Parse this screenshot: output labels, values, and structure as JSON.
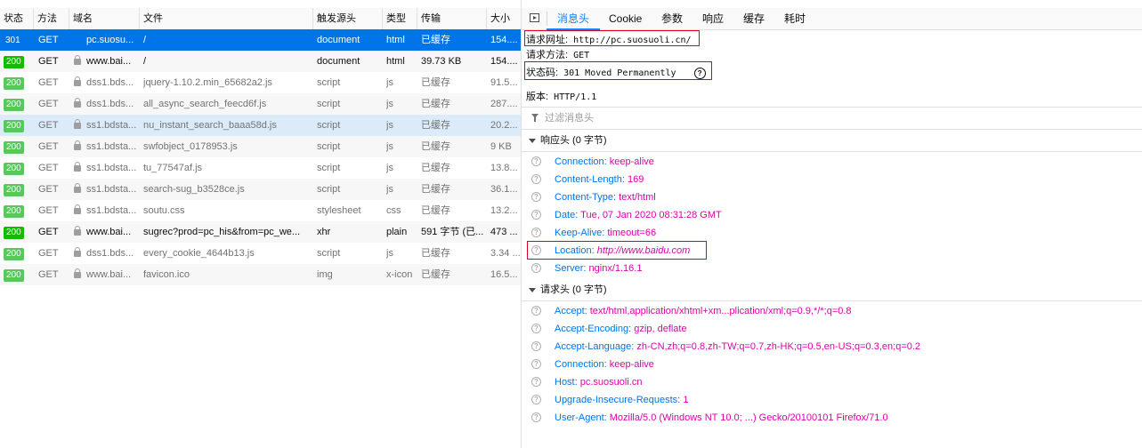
{
  "table": {
    "columns": [
      "状态",
      "方法",
      "域名",
      "文件",
      "触发源头",
      "类型",
      "传输",
      "大小"
    ],
    "rows": [
      {
        "status": "301",
        "method": "GET",
        "domain": "pc.suosu...",
        "lock": false,
        "file": "/",
        "cause": "document",
        "type": "html",
        "transferred": "已缓存",
        "size": "154...."
      },
      {
        "status": "200",
        "method": "GET",
        "domain": "www.bai...",
        "lock": true,
        "file": "/",
        "cause": "document",
        "type": "html",
        "transferred": "39.73 KB",
        "size": "154...."
      },
      {
        "status": "200",
        "method": "GET",
        "domain": "dss1.bds...",
        "lock": true,
        "file": "jquery-1.10.2.min_65682a2.js",
        "cause": "script",
        "type": "js",
        "transferred": "已缓存",
        "size": "91.5..."
      },
      {
        "status": "200",
        "method": "GET",
        "domain": "dss1.bds...",
        "lock": true,
        "file": "all_async_search_feecd6f.js",
        "cause": "script",
        "type": "js",
        "transferred": "已缓存",
        "size": "287...."
      },
      {
        "status": "200",
        "method": "GET",
        "domain": "ss1.bdsta...",
        "lock": true,
        "file": "nu_instant_search_baaa58d.js",
        "cause": "script",
        "type": "js",
        "transferred": "已缓存",
        "size": "20.2..."
      },
      {
        "status": "200",
        "method": "GET",
        "domain": "ss1.bdsta...",
        "lock": true,
        "file": "swfobject_0178953.js",
        "cause": "script",
        "type": "js",
        "transferred": "已缓存",
        "size": "9 KB"
      },
      {
        "status": "200",
        "method": "GET",
        "domain": "ss1.bdsta...",
        "lock": true,
        "file": "tu_77547af.js",
        "cause": "script",
        "type": "js",
        "transferred": "已缓存",
        "size": "13.8..."
      },
      {
        "status": "200",
        "method": "GET",
        "domain": "ss1.bdsta...",
        "lock": true,
        "file": "search-sug_b3528ce.js",
        "cause": "script",
        "type": "js",
        "transferred": "已缓存",
        "size": "36.1..."
      },
      {
        "status": "200",
        "method": "GET",
        "domain": "ss1.bdsta...",
        "lock": true,
        "file": "soutu.css",
        "cause": "stylesheet",
        "type": "css",
        "transferred": "已缓存",
        "size": "13.2..."
      },
      {
        "status": "200",
        "method": "GET",
        "domain": "www.bai...",
        "lock": true,
        "file": "sugrec?prod=pc_his&from=pc_we...",
        "cause": "xhr",
        "type": "plain",
        "transferred": "591 字节 (已...",
        "size": "473 ..."
      },
      {
        "status": "200",
        "method": "GET",
        "domain": "dss1.bds...",
        "lock": true,
        "file": "every_cookie_4644b13.js",
        "cause": "script",
        "type": "js",
        "transferred": "已缓存",
        "size": "3.34 ..."
      },
      {
        "status": "200",
        "method": "GET",
        "domain": "www.bai...",
        "lock": true,
        "file": "favicon.ico",
        "cause": "img",
        "type": "x-icon",
        "transferred": "已缓存",
        "size": "16.5..."
      }
    ]
  },
  "tabs": [
    "消息头",
    "Cookie",
    "参数",
    "响应",
    "缓存",
    "耗时"
  ],
  "summary": {
    "url_label": "请求网址:",
    "url_value": "http://pc.suosuoli.cn/",
    "method_label": "请求方法:",
    "method_value": "GET",
    "status_label": "状态码:",
    "status_value": "301  Moved Permanently",
    "help_glyph": "?",
    "version_label": "版本:",
    "version_value": "HTTP/1.1"
  },
  "filter_placeholder": "过滤消息头",
  "response_section": "响应头 (0 字节)",
  "response_headers": [
    {
      "name": "Connection:",
      "value": "keep-alive"
    },
    {
      "name": "Content-Length:",
      "value": "169"
    },
    {
      "name": "Content-Type:",
      "value": "text/html"
    },
    {
      "name": "Date:",
      "value": "Tue, 07 Jan 2020 08:31:28 GMT"
    },
    {
      "name": "Keep-Alive:",
      "value": "timeout=66"
    },
    {
      "name": "Location:",
      "value": "http://www.baidu.com"
    },
    {
      "name": "Server:",
      "value": "nginx/1.16.1"
    }
  ],
  "request_section": "请求头 (0 字节)",
  "request_headers": [
    {
      "name": "Accept:",
      "value": "text/html,application/xhtml+xm...plication/xml;q=0.9,*/*;q=0.8"
    },
    {
      "name": "Accept-Encoding:",
      "value": "gzip, deflate"
    },
    {
      "name": "Accept-Language:",
      "value": "zh-CN,zh;q=0.8,zh-TW;q=0.7,zh-HK;q=0.5,en-US;q=0.3,en;q=0.2"
    },
    {
      "name": "Connection:",
      "value": "keep-alive"
    },
    {
      "name": "Host:",
      "value": "pc.suosuoli.cn"
    },
    {
      "name": "Upgrade-Insecure-Requests:",
      "value": "1"
    },
    {
      "name": "User-Agent:",
      "value": "Mozilla/5.0 (Windows NT 10.0; ...) Gecko/20100101 Firefox/71.0"
    }
  ],
  "colors": {
    "accent": "#0a84ff",
    "selected_row": "#0074e8",
    "status_ok": "#12bc00",
    "header_name": "#0074e8",
    "header_value": "#dd00a9",
    "annotation": "#d70022"
  }
}
